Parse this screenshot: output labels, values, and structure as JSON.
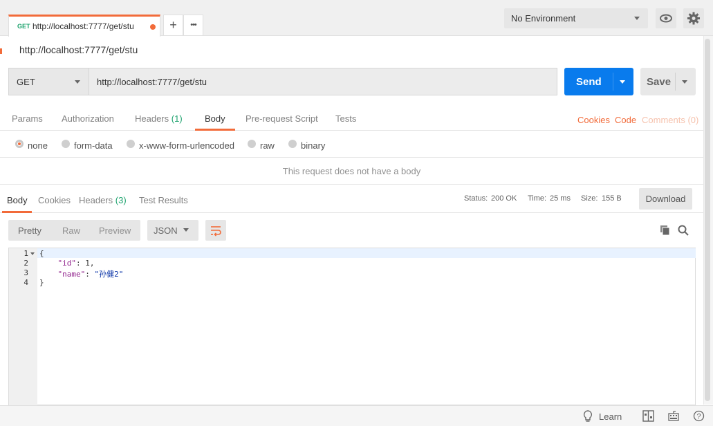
{
  "tab": {
    "method": "GET",
    "url": "http://localhost:7777/get/stu"
  },
  "tab_actions": {
    "new": "+",
    "more": "•••"
  },
  "environment": {
    "selected": "No Environment"
  },
  "request": {
    "title": "http://localhost:7777/get/stu",
    "method": "GET",
    "url": "http://localhost:7777/get/stu",
    "send_label": "Send",
    "save_label": "Save"
  },
  "request_tabs": {
    "params": "Params",
    "authorization": "Authorization",
    "headers": "Headers",
    "headers_count": "(1)",
    "body": "Body",
    "prerequest": "Pre-request Script",
    "tests": "Tests",
    "cookies": "Cookies",
    "code": "Code",
    "comments": "Comments (0)"
  },
  "body_types": {
    "none": "none",
    "form_data": "form-data",
    "urlencoded": "x-www-form-urlencoded",
    "raw": "raw",
    "binary": "binary",
    "selected": "none"
  },
  "no_body_message": "This request does not have a body",
  "response_tabs": {
    "body": "Body",
    "cookies": "Cookies",
    "headers": "Headers",
    "headers_count": "(3)",
    "test_results": "Test Results"
  },
  "response_status": {
    "status_label": "Status:",
    "status_value": "200 OK",
    "time_label": "Time:",
    "time_value": "25 ms",
    "size_label": "Size:",
    "size_value": "155 B",
    "download_label": "Download"
  },
  "response_format": {
    "pretty": "Pretty",
    "raw": "Raw",
    "preview": "Preview",
    "language": "JSON"
  },
  "code_lines": {
    "n1": "1",
    "n2": "2",
    "n3": "3",
    "n4": "4",
    "l1": "{",
    "l2_key": "\"id\"",
    "l2_rest": ": 1,",
    "l3_key": "\"name\"",
    "l3_sep": ": ",
    "l3_val": "\"孙健2\"",
    "l4": "}"
  },
  "statusbar": {
    "learn": "Learn"
  },
  "colors": {
    "accent": "#f26b3a",
    "send": "#097bed",
    "success": "#1ea36e"
  }
}
